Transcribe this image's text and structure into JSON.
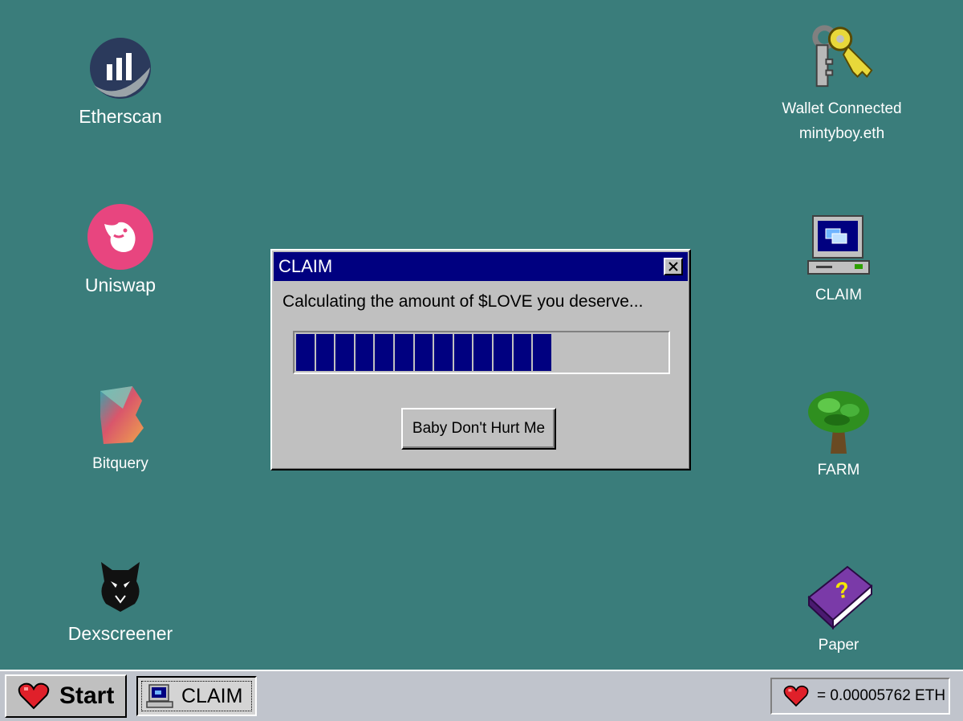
{
  "desktop": {
    "background": "#3a7d7b",
    "left_icons": [
      {
        "label": "Etherscan",
        "icon": "etherscan-icon"
      },
      {
        "label": "Uniswap",
        "icon": "uniswap-icon"
      },
      {
        "label": "Bitquery",
        "icon": "bitquery-icon"
      },
      {
        "label": "Dexscreener",
        "icon": "dexscreener-icon"
      }
    ],
    "wallet": {
      "line1": "Wallet Connected",
      "line2": "mintyboy.eth",
      "icon": "keys-icon"
    },
    "right_icons": [
      {
        "label": "CLAIM",
        "icon": "computer-icon"
      },
      {
        "label": "FARM",
        "icon": "tree-icon"
      },
      {
        "label": "Paper",
        "icon": "help-book-icon"
      }
    ]
  },
  "dialog": {
    "title": "CLAIM",
    "message": "Calculating the amount of $LOVE you deserve...",
    "progress_fraction": 0.68,
    "button_label": "Baby Don't Hurt Me",
    "title_color": "#000080"
  },
  "taskbar": {
    "start_label": "Start",
    "task_label": "CLAIM",
    "tray_text": "= 0.00005762 ETH"
  }
}
